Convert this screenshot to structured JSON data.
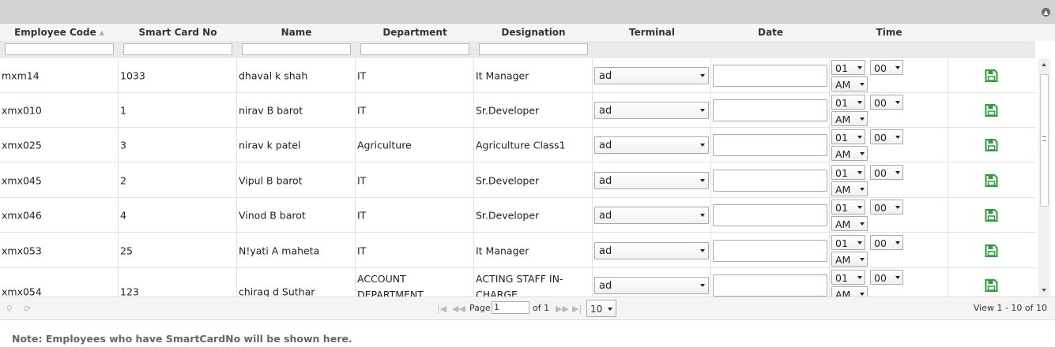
{
  "grid": {
    "columns": [
      {
        "label": "Employee Code",
        "sortable": true
      },
      {
        "label": "Smart Card No"
      },
      {
        "label": "Name"
      },
      {
        "label": "Department"
      },
      {
        "label": "Designation"
      },
      {
        "label": "Terminal"
      },
      {
        "label": "Date"
      },
      {
        "label": "Time"
      }
    ],
    "rows": [
      {
        "code": "mxm14",
        "card": "1033",
        "name": "dhaval k shah",
        "dept": "IT",
        "desig": "It Manager",
        "terminal": "ad",
        "hour": "01",
        "min": "00",
        "ampm": "AM"
      },
      {
        "code": "xmx010",
        "card": "1",
        "name": "nirav B barot",
        "dept": "IT",
        "desig": "Sr.Developer",
        "terminal": "ad",
        "hour": "01",
        "min": "00",
        "ampm": "AM"
      },
      {
        "code": "xmx025",
        "card": "3",
        "name": "nirav k patel",
        "dept": "Agriculture",
        "desig": "Agriculture Class1",
        "terminal": "ad",
        "hour": "01",
        "min": "00",
        "ampm": "AM"
      },
      {
        "code": "xmx045",
        "card": "2",
        "name": "Vipul B barot",
        "dept": "IT",
        "desig": "Sr.Developer",
        "terminal": "ad",
        "hour": "01",
        "min": "00",
        "ampm": "AM"
      },
      {
        "code": "xmx046",
        "card": "4",
        "name": "Vinod B barot",
        "dept": "IT",
        "desig": "Sr.Developer",
        "terminal": "ad",
        "hour": "01",
        "min": "00",
        "ampm": "AM"
      },
      {
        "code": "xmx053",
        "card": "25",
        "name": "N!yati A maheta",
        "dept": "IT",
        "desig": "It Manager",
        "terminal": "ad",
        "hour": "01",
        "min": "00",
        "ampm": "AM"
      },
      {
        "code": "xmx054",
        "card": "123",
        "name": "chirag d Suthar",
        "dept": "ACCOUNT DEPARTMENT",
        "desig": "ACTING STAFF IN-CHARGE",
        "terminal": "ad",
        "hour": "01",
        "min": "00",
        "ampm": "AM"
      }
    ]
  },
  "pager": {
    "page_label": "Page",
    "page_value": "1",
    "of_label": "of 1",
    "rows_per_page": "10",
    "view_info": "View 1 - 10 of 10"
  },
  "note": "Note: Employees who have SmartCardNo will be shown here.",
  "colors": {
    "titlebar": "#d3d3d3",
    "save_icon": "#2e9e3b"
  },
  "icons": {
    "collapse": "collapse-icon",
    "save": "save-icon",
    "search": "search-icon",
    "refresh": "refresh-icon"
  }
}
